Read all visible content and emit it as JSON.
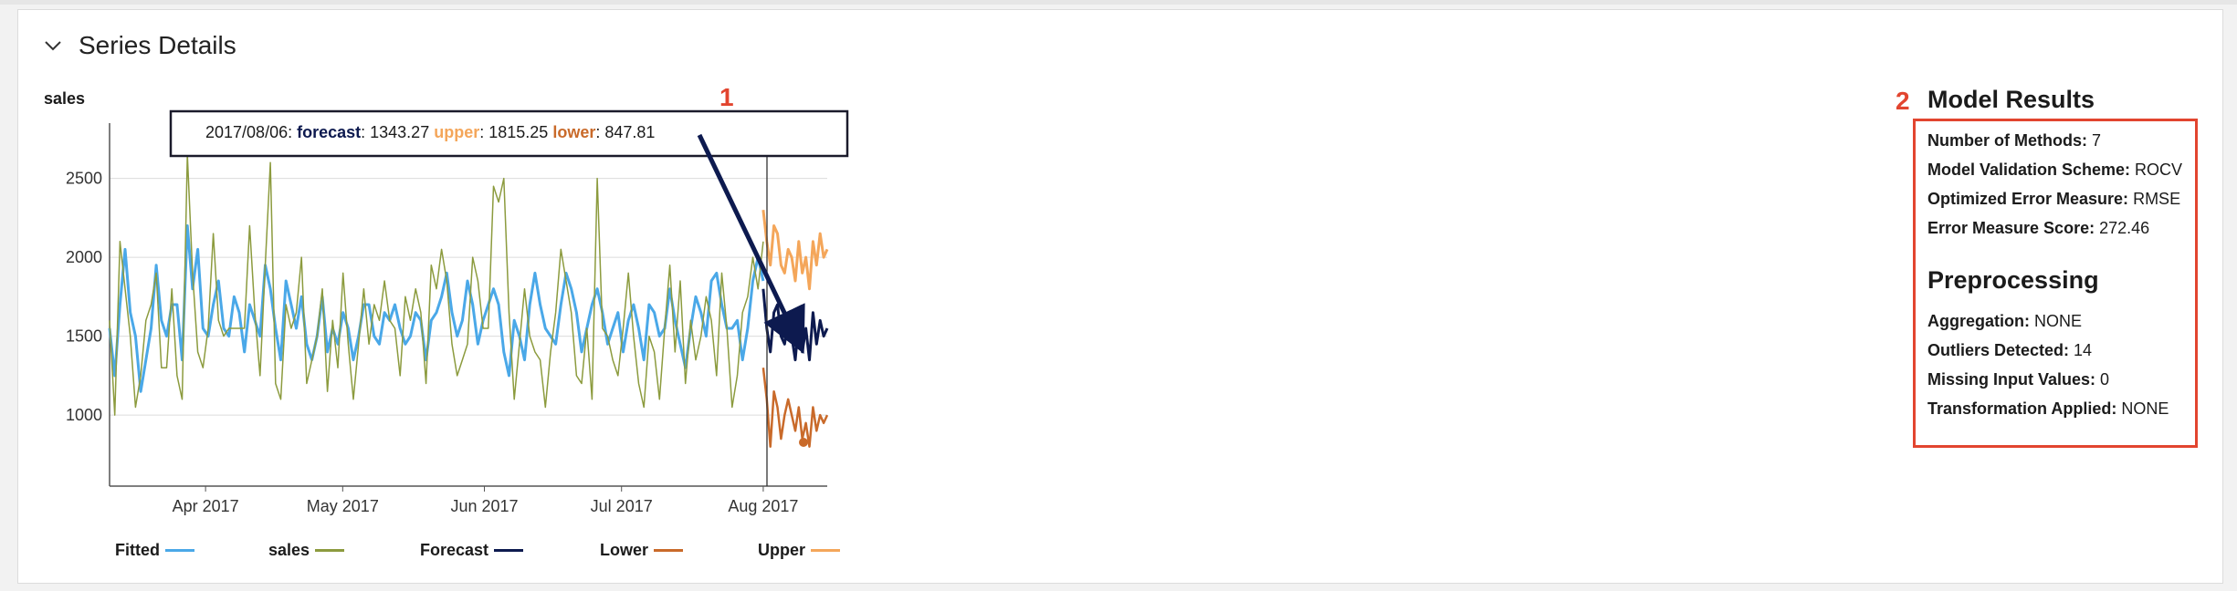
{
  "section": {
    "title": "Series Details"
  },
  "chart_data": {
    "type": "line",
    "ylabel": "sales",
    "yticks": [
      1000,
      1500,
      2000,
      2500
    ],
    "ylim": [
      550,
      2850
    ],
    "xticks": [
      "Apr 2017",
      "May 2017",
      "Jun 2017",
      "Jul 2017",
      "Aug 2017"
    ],
    "xtick_dates": [
      "2017-04-01",
      "2017-05-01",
      "2017-06-01",
      "2017-07-01",
      "2017-08-01"
    ],
    "xlim": [
      "2017-03-11",
      "2017-08-15"
    ],
    "grid": true,
    "legend_position": "bottom",
    "forecast_start": "2017-08-01",
    "tooltip": {
      "date": "2017/08/06:",
      "forecast_label": "forecast",
      "forecast_value": ": 1343.27",
      "upper_label": "upper",
      "upper_value": ": 1815.25",
      "lower_label": "lower",
      "lower_value": ": 847.81"
    },
    "series": [
      {
        "name": "Fitted",
        "color": "#4aa8e8",
        "values": [
          1550,
          1250,
          1700,
          2050,
          1650,
          1500,
          1150,
          1350,
          1550,
          1950,
          1600,
          1500,
          1700,
          1700,
          1350,
          2200,
          1800,
          2050,
          1550,
          1500,
          1700,
          1850,
          1550,
          1500,
          1750,
          1650,
          1400,
          1700,
          1600,
          1500,
          1950,
          1800,
          1550,
          1350,
          1850,
          1700,
          1550,
          1750,
          1450,
          1350,
          1500,
          1750,
          1400,
          1550,
          1450,
          1650,
          1550,
          1350,
          1500,
          1700,
          1700,
          1500,
          1450,
          1650,
          1600,
          1700,
          1550,
          1450,
          1500,
          1650,
          1600,
          1350,
          1600,
          1650,
          1750,
          1900,
          1650,
          1500,
          1600,
          1850,
          1700,
          1450,
          1600,
          1700,
          1800,
          1700,
          1400,
          1250,
          1600,
          1500,
          1350,
          1700,
          1900,
          1700,
          1550,
          1500,
          1450,
          1700,
          1900,
          1800,
          1650,
          1400,
          1550,
          1700,
          1800,
          1650,
          1450,
          1550,
          1650,
          1400,
          1600,
          1700,
          1550,
          1350,
          1700,
          1650,
          1500,
          1550,
          1800,
          1600,
          1450,
          1300,
          1550,
          1750,
          1650,
          1500,
          1850,
          1900,
          1700,
          1550,
          1550,
          1600,
          1350,
          1550,
          1850,
          2000,
          1850
        ]
      },
      {
        "name": "sales",
        "color": "#8c9b3e",
        "values": [
          1600,
          1000,
          2100,
          1800,
          1500,
          1050,
          1250,
          1600,
          1700,
          1900,
          1300,
          1300,
          1800,
          1250,
          1100,
          2650,
          1900,
          1400,
          1300,
          1550,
          2150,
          1600,
          1500,
          1550,
          1550,
          1550,
          1550,
          2200,
          1650,
          1250,
          1950,
          2600,
          1200,
          1100,
          1700,
          1550,
          1650,
          2000,
          1200,
          1350,
          1500,
          1800,
          1150,
          1600,
          1300,
          1900,
          1450,
          1100,
          1450,
          1800,
          1450,
          1700,
          1600,
          1850,
          1600,
          1550,
          1250,
          1750,
          1600,
          1800,
          1650,
          1200,
          1950,
          1800,
          2050,
          1850,
          1450,
          1250,
          1350,
          1450,
          2000,
          1850,
          1550,
          1550,
          2450,
          2350,
          2500,
          1650,
          1100,
          1450,
          1800,
          1500,
          1400,
          1350,
          1050,
          1400,
          1650,
          2050,
          1850,
          1650,
          1250,
          1200,
          1550,
          1100,
          2500,
          1550,
          1500,
          1350,
          1250,
          1550,
          1900,
          1500,
          1200,
          1050,
          1500,
          1400,
          1100,
          1550,
          1950,
          1400,
          1850,
          1200,
          1600,
          1350,
          1500,
          1750,
          1600,
          1250,
          1900,
          1550,
          1050,
          1250,
          1650,
          1750,
          2000,
          1800,
          2100
        ]
      },
      {
        "name": "Forecast",
        "color": "#0d1a4f",
        "values": [
          1800,
          1550,
          1400,
          1650,
          1700,
          1500,
          1450,
          1600,
          1500,
          1350,
          1600,
          1400,
          1550,
          1350,
          1650,
          1450,
          1600,
          1500,
          1550
        ]
      },
      {
        "name": "Lower",
        "color": "#c96a2a",
        "values": [
          1300,
          1100,
          800,
          1150,
          1050,
          850,
          1000,
          1100,
          1000,
          900,
          1050,
          850,
          950,
          800,
          1050,
          900,
          1000,
          950,
          1000
        ]
      },
      {
        "name": "Upper",
        "color": "#f4a65a",
        "values": [
          2300,
          2100,
          1950,
          2200,
          2150,
          1950,
          1900,
          2050,
          2000,
          1850,
          2100,
          1900,
          2000,
          1800,
          2100,
          1950,
          2150,
          2000,
          2050
        ]
      }
    ]
  },
  "model_results": {
    "callout_number": "2",
    "title": "Model Results",
    "rows": [
      {
        "label": "Number of Methods:",
        "value": " 7"
      },
      {
        "label": "Model Validation Scheme:",
        "value": " ROCV"
      },
      {
        "label": "Optimized Error Measure:",
        "value": " RMSE"
      },
      {
        "label": "Error Measure Score:",
        "value": " 272.46"
      }
    ]
  },
  "preprocessing": {
    "title": "Preprocessing",
    "rows": [
      {
        "label": "Aggregation:",
        "value": " NONE"
      },
      {
        "label": "Outliers Detected:",
        "value": " 14"
      },
      {
        "label": "Missing Input Values:",
        "value": " 0"
      },
      {
        "label": "Transformation Applied:",
        "value": " NONE"
      }
    ]
  },
  "annotations": {
    "callout_1": "1",
    "arrow_color": "#0d1a4f",
    "highlight_color": "#e2452f"
  }
}
